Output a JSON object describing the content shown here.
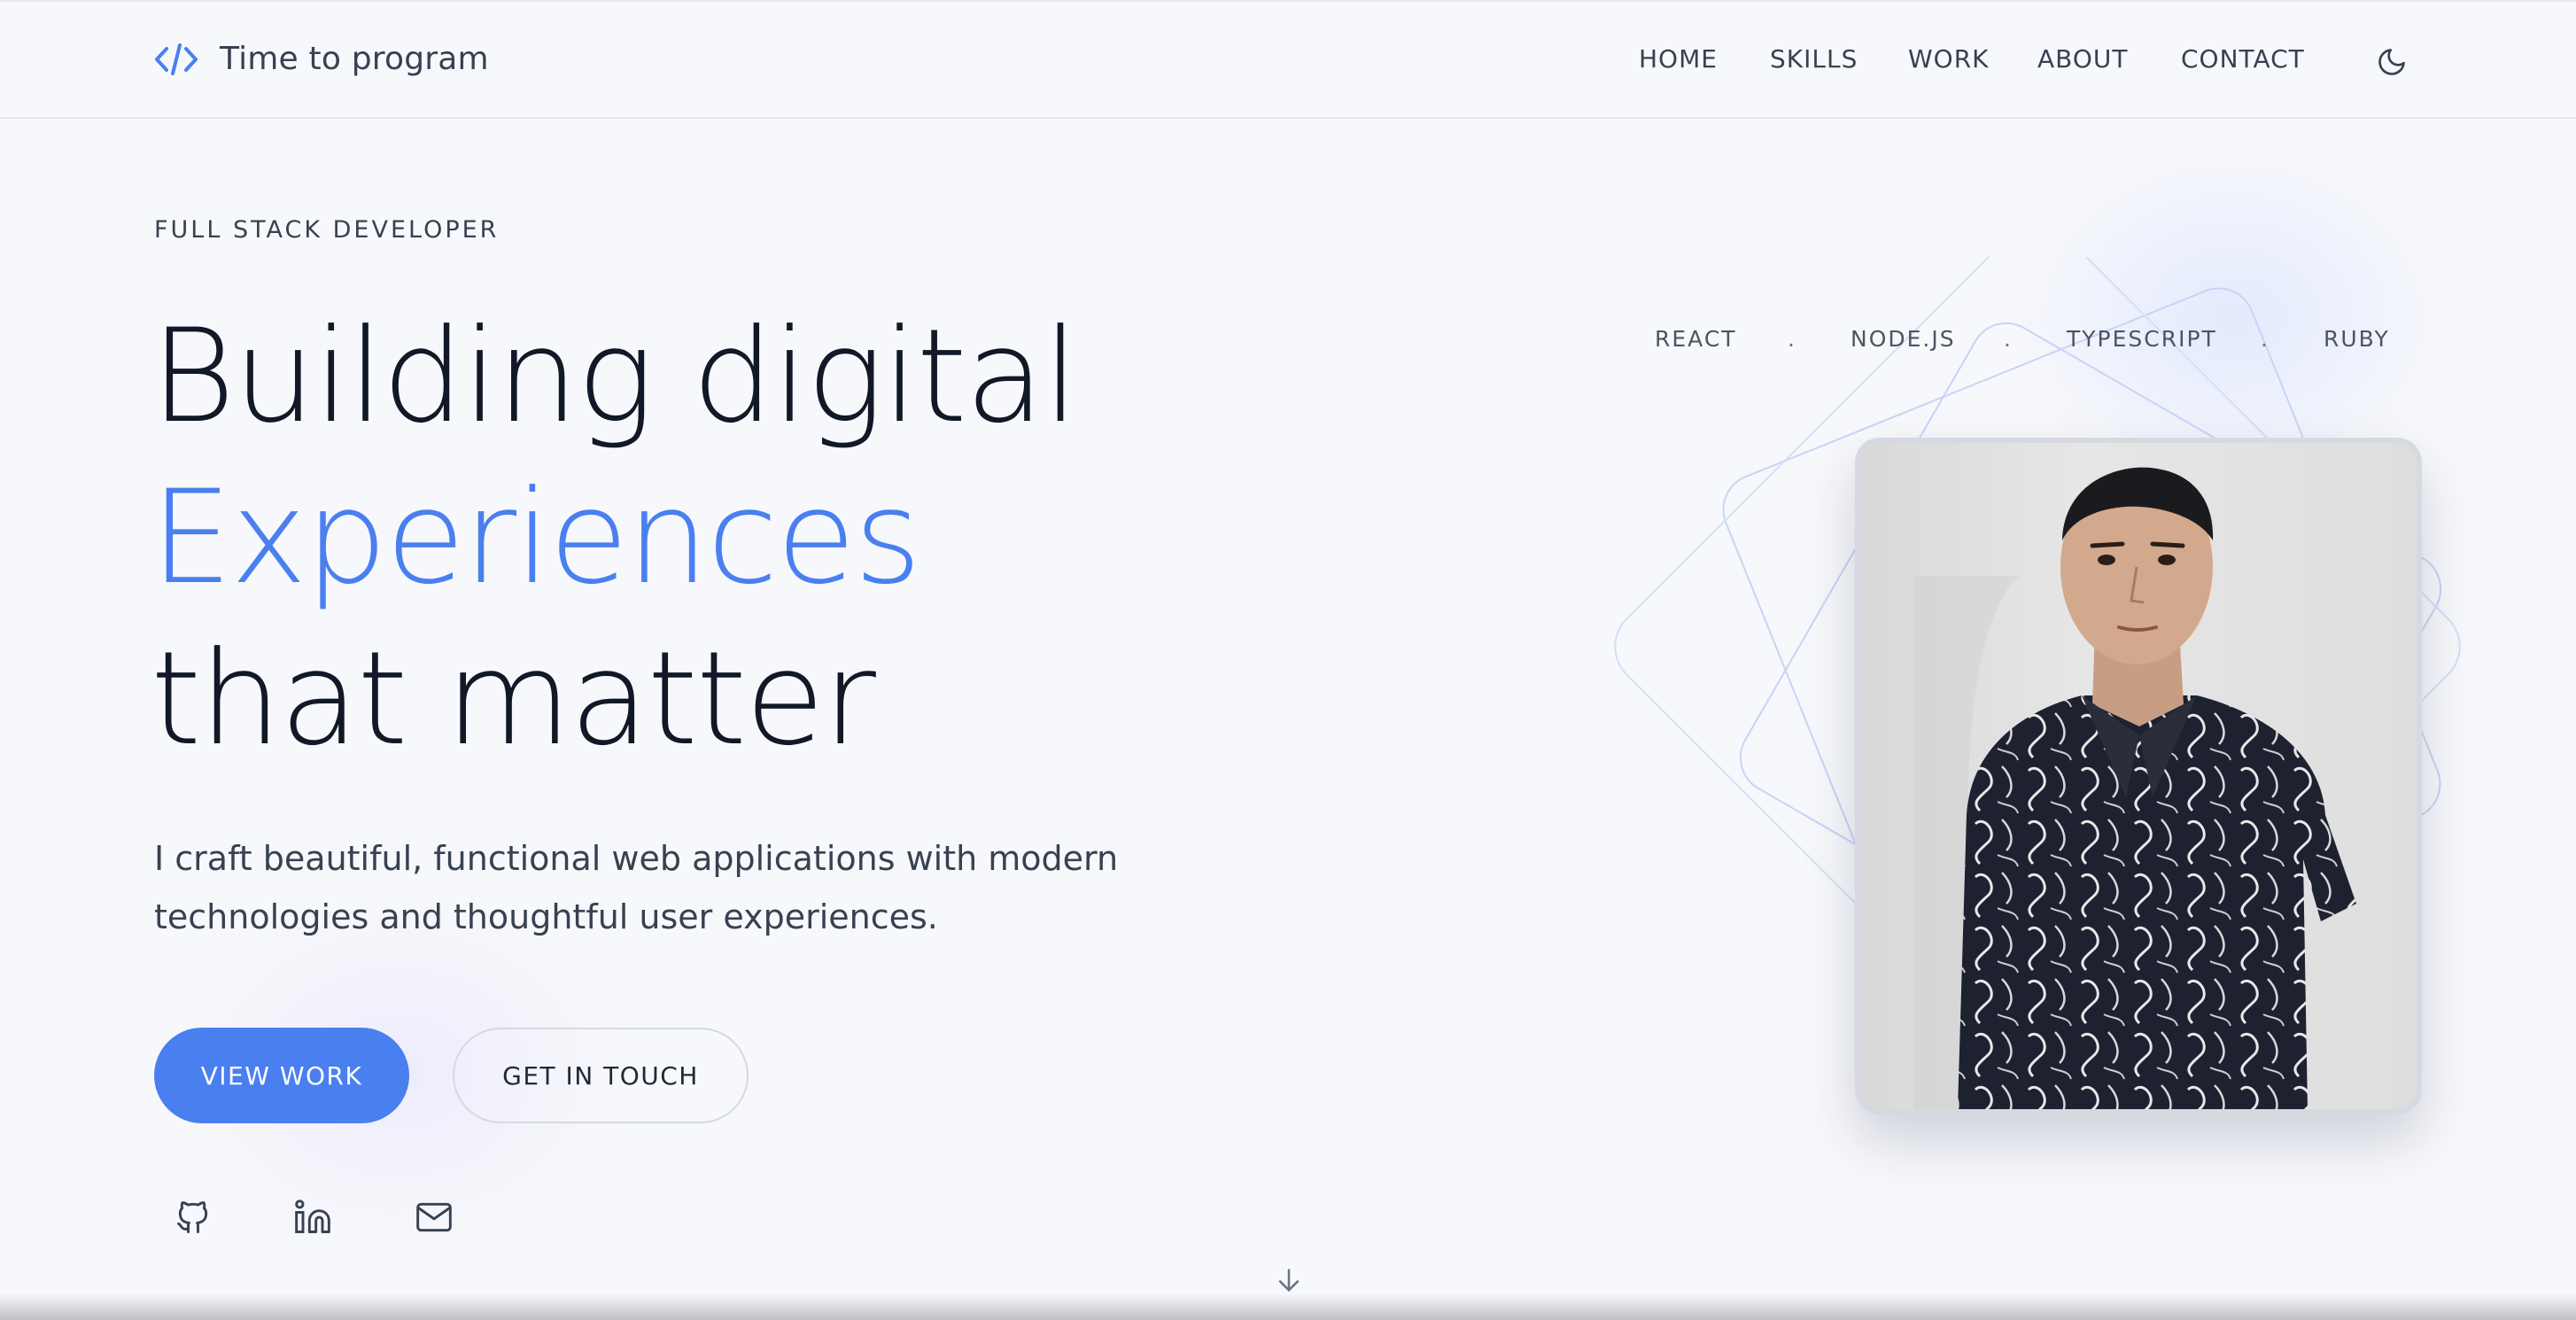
{
  "header": {
    "brand_name": "Time to program",
    "nav": [
      "HOME",
      "SKILLS",
      "WORK",
      "ABOUT",
      "CONTACT"
    ]
  },
  "hero": {
    "eyebrow": "FULL STACK DEVELOPER",
    "headline_line1": "Building digital",
    "headline_line2": "Experiences",
    "headline_line3": "that matter",
    "description": "I craft beautiful, functional web applications with modern technologies and thoughtful user experiences.",
    "primary_button": "VIEW WORK",
    "secondary_button": "GET IN TOUCH"
  },
  "tech_stack": [
    "REACT",
    "NODE.JS",
    "TYPESCRIPT",
    "RUBY"
  ],
  "tech_separator": ".",
  "icons": {
    "brand": "code-icon",
    "theme": "moon-icon",
    "social": [
      "github-icon",
      "linkedin-icon",
      "mail-icon"
    ],
    "scroll": "arrow-down-icon"
  },
  "colors": {
    "accent": "#4a7ff0",
    "background": "#f7f8fb",
    "text": "#111827"
  }
}
